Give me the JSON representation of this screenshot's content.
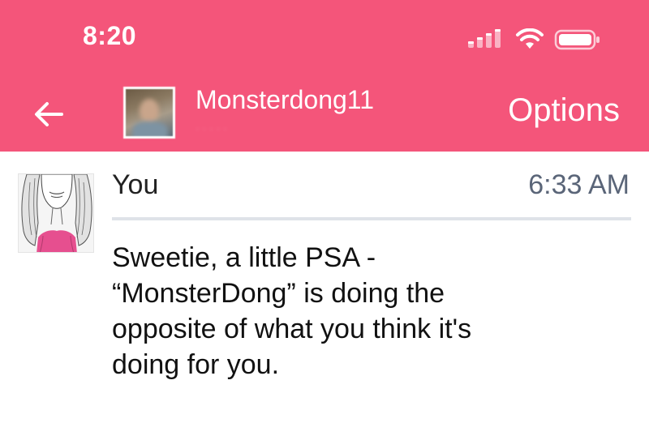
{
  "status_bar": {
    "time": "8:20",
    "icons": [
      "cellular-signal-icon",
      "wifi-icon",
      "battery-icon"
    ]
  },
  "header": {
    "background_color": "#f4557a",
    "username": "Monsterdong11",
    "subtitle": "· · · · ·",
    "options_label": "Options",
    "back_icon": "arrow-left-icon"
  },
  "message": {
    "sender": "You",
    "time": "6:33 AM",
    "lines": [
      "Sweetie, a little PSA -",
      "“MonsterDong” is doing the",
      "opposite of what you think it's",
      "doing for you."
    ]
  }
}
